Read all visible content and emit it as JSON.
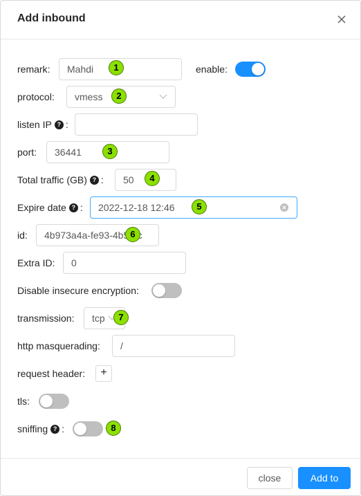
{
  "dialog": {
    "title": "Add inbound"
  },
  "form": {
    "remark_label": "remark",
    "remark_value": "Mahdi",
    "enable_label": "enable",
    "enable_on": true,
    "protocol_label": "protocol",
    "protocol_value": "vmess",
    "listen_ip_label": "listen IP",
    "listen_ip_value": "",
    "port_label": "port",
    "port_value": "36441",
    "total_traffic_label": "Total traffic (GB)",
    "total_traffic_value": "50",
    "expire_label": "Expire date",
    "expire_value": "2022-12-18 12:46",
    "id_label": "id",
    "id_value": "4b973a4a-fe93-4b57-c",
    "extra_id_label": "Extra ID",
    "extra_id_value": "0",
    "disable_insecure_label": "Disable insecure encryption",
    "disable_insecure_on": false,
    "transmission_label": "transmission",
    "transmission_value": "tcp",
    "http_masq_label": "http masquerading",
    "http_masq_value": "/",
    "request_header_label": "request header",
    "request_header_add": "+",
    "tls_label": "tls",
    "tls_on": false,
    "sniffing_label": "sniffing",
    "sniffing_on": false,
    "colon": ":",
    "help_glyph": "?"
  },
  "annotations": [
    "1",
    "2",
    "3",
    "4",
    "5",
    "6",
    "7",
    "8"
  ],
  "footer": {
    "close_label": "close",
    "add_label": "Add to"
  },
  "colors": {
    "primary": "#1890ff",
    "switch_off": "#bfbfbf",
    "badge": "#8be000",
    "border": "#d9d9d9"
  },
  "icons": {
    "close": "close-icon",
    "dropdown": "chevron-down-icon",
    "clear": "clear-circle-icon",
    "help": "question-circle-icon",
    "add": "plus-icon"
  }
}
